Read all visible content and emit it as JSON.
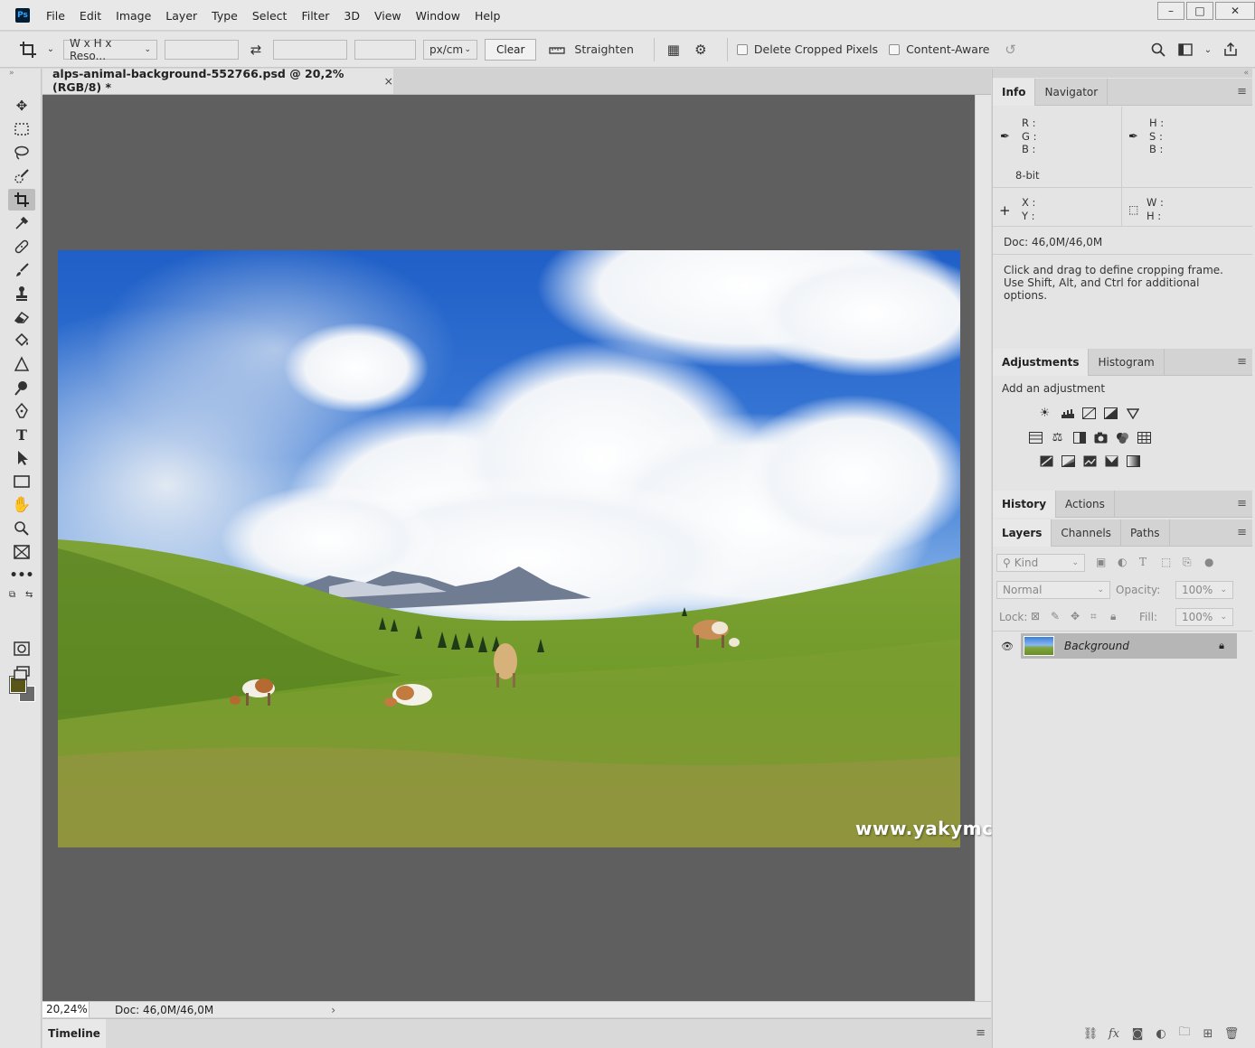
{
  "menubar": {
    "app_icon": "Ps",
    "items": [
      "File",
      "Edit",
      "Image",
      "Layer",
      "Type",
      "Select",
      "Filter",
      "3D",
      "View",
      "Window",
      "Help"
    ]
  },
  "window_controls": {
    "minimize": "–",
    "restore": "□",
    "close": "✕"
  },
  "options_bar": {
    "ratio_preset": "W x H x Reso...",
    "unit": "px/cm",
    "clear_label": "Clear",
    "straighten_label": "Straighten",
    "delete_cropped_label": "Delete Cropped Pixels",
    "content_aware_label": "Content-Aware"
  },
  "document": {
    "tab_title": "alps-animal-background-552766.psd @ 20,2% (RGB/8) *",
    "tab_close": "×",
    "watermark": "www.yakymchuk.net",
    "zoom": "20,24%",
    "doc_size": "Doc: 46,0M/46,0M",
    "status_arrow": "›"
  },
  "timeline": {
    "label": "Timeline"
  },
  "info_panel": {
    "tabs": [
      "Info",
      "Navigator"
    ],
    "rgb_labels": [
      "R :",
      "G :",
      "B :"
    ],
    "hsb_labels": [
      "H :",
      "S :",
      "B :"
    ],
    "bit_depth": "8-bit",
    "xy_labels": [
      "X :",
      "Y :"
    ],
    "wh_labels": [
      "W :",
      "H :"
    ],
    "doc_size": "Doc: 46,0M/46,0M",
    "hint": "Click and drag to define cropping frame. Use Shift, Alt, and Ctrl for additional options."
  },
  "adjustments_panel": {
    "tabs": [
      "Adjustments",
      "Histogram"
    ],
    "heading": "Add an adjustment"
  },
  "history_panel": {
    "tabs": [
      "History",
      "Actions"
    ]
  },
  "layers_panel": {
    "tabs": [
      "Layers",
      "Channels",
      "Paths"
    ],
    "kind_placeholder": "Kind",
    "blend_mode": "Normal",
    "opacity_label": "Opacity:",
    "opacity_value": "100%",
    "lock_label": "Lock:",
    "fill_label": "Fill:",
    "fill_value": "100%",
    "layer_name": "Background"
  },
  "colors": {
    "foreground": "#5a5518",
    "background": "#6a6a6a",
    "canvas_bg": "#5f5f5f"
  }
}
